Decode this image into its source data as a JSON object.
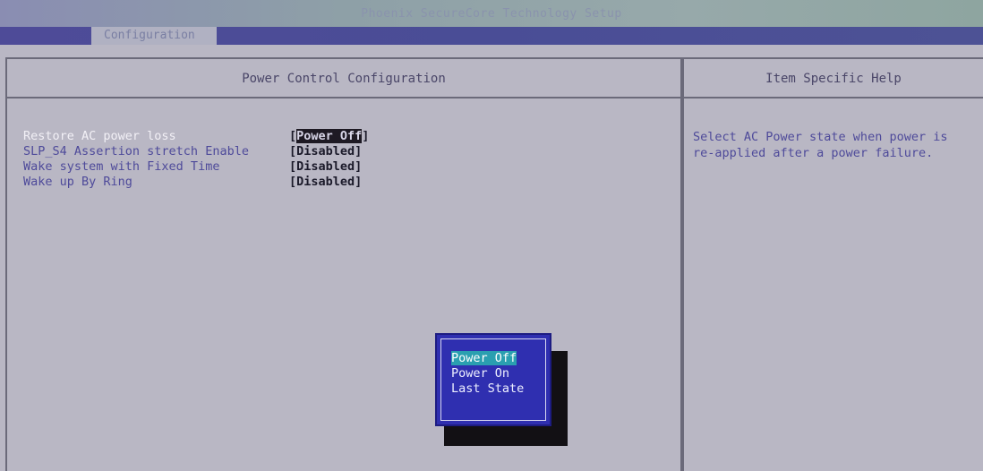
{
  "window": {
    "title": "Phoenix SecureCore Technology Setup"
  },
  "menu": {
    "active_tab": "Configuration"
  },
  "left_panel": {
    "header": "Power Control Configuration",
    "settings": [
      {
        "label": "Restore AC power loss",
        "value": "Power Off",
        "active": true
      },
      {
        "label": "SLP_S4 Assertion stretch Enable",
        "value": "Disabled",
        "active": false
      },
      {
        "label": "Wake system with Fixed Time",
        "value": "Disabled",
        "active": false
      },
      {
        "label": "Wake up By Ring",
        "value": "Disabled",
        "active": false
      }
    ],
    "bracket_open": "[",
    "bracket_close": "]"
  },
  "right_panel": {
    "header": "Item Specific Help",
    "help_text": "Select AC Power state when power is\nre-applied after a power failure."
  },
  "popup": {
    "options": [
      "Power Off",
      "Power On",
      "Last State"
    ],
    "selected": "Power Off"
  },
  "colors": {
    "background": "#b9b7c4",
    "menu_bar": "#4e4b98",
    "label_text": "#4e4a9a",
    "popup_bg": "#2f2fb0",
    "selection": "#2a9fb0"
  }
}
